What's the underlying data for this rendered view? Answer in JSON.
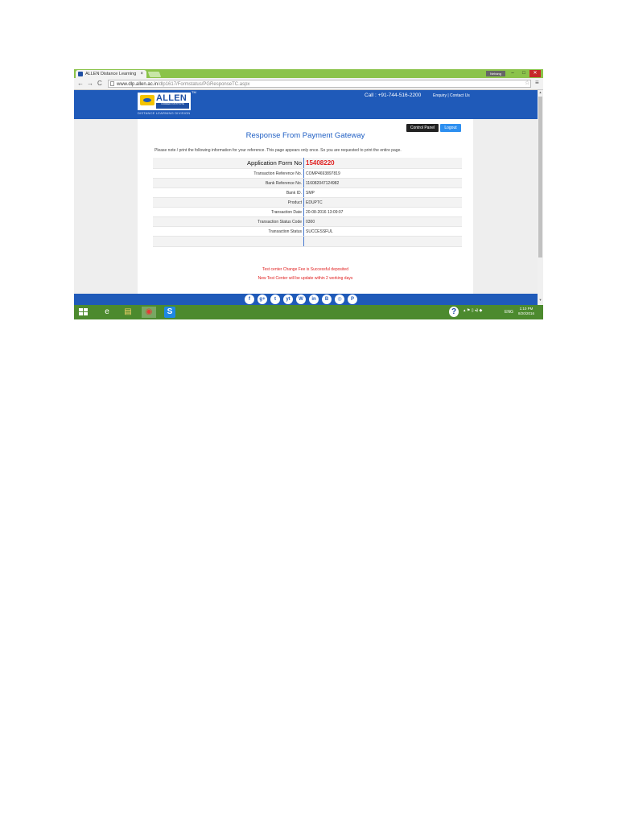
{
  "browser": {
    "tab_title": "ALLEN Distance Learning",
    "tab_close": "×",
    "user_badge": "Nehang",
    "url_host": "www.dlp.allen.ac.in",
    "url_path": "/dlp1617/Formstatus/PGResponseTC.aspx",
    "back": "←",
    "forward": "→",
    "reload": "C",
    "star": "☆",
    "menu": "≡",
    "minimize": "–",
    "maximize": "□",
    "close": "✕"
  },
  "site": {
    "logo_name": "ALLEN",
    "logo_sub": "CAREER INSTITUTE",
    "logo_caption": "DISTANCE LEARNING DIVISION",
    "trademark": "TM",
    "phone": "Call : +91-744-516-2200",
    "links": "Enquiry | Contact Us"
  },
  "content": {
    "control_panel_label": "Control Panel",
    "logout_label": "Logout",
    "heading": "Response From Payment Gateway",
    "note": "Please note / print the following information for your reference. This page appears only once. So you are requested to print the entire page.",
    "application_label": "Application Form No",
    "application_value": "15408220",
    "rows": [
      {
        "label": "Transaction Reference No.",
        "value": "COMP4693897819"
      },
      {
        "label": "Bank Reference No.",
        "value": "116082047124982"
      },
      {
        "label": "Bank ID.",
        "value": "SMP"
      },
      {
        "label": "Product",
        "value": "EDUPTC"
      },
      {
        "label": "Transaction Date",
        "value": "20-08-2016 13:09:07"
      },
      {
        "label": "Transaction Status Code",
        "value": "0300"
      },
      {
        "label": "Transaction Status",
        "value": "SUCCESSFUL"
      }
    ],
    "message1": "Test center Change Fee is Successful deposited",
    "message2": "New Test Center will be update within 2 working days"
  },
  "social": [
    "f",
    "g+",
    "t",
    "yt",
    "W",
    "in",
    "B",
    "◎",
    "P"
  ],
  "taskbar": {
    "ie": "e",
    "explorer": "▤",
    "chrome": "◉",
    "skype": "S",
    "help": "?",
    "tray": "▴ ⚑ ▯ ◂) ◆",
    "lang": "ENG",
    "time": "1:10 PM",
    "date": "8/20/2016"
  },
  "colors": {
    "brand_blue": "#1f5ab9",
    "heading_blue": "#2160c4",
    "accent_red": "#e02020",
    "taskbar_green": "#4c8a2e",
    "tabstrip_green": "#8bc34a"
  }
}
